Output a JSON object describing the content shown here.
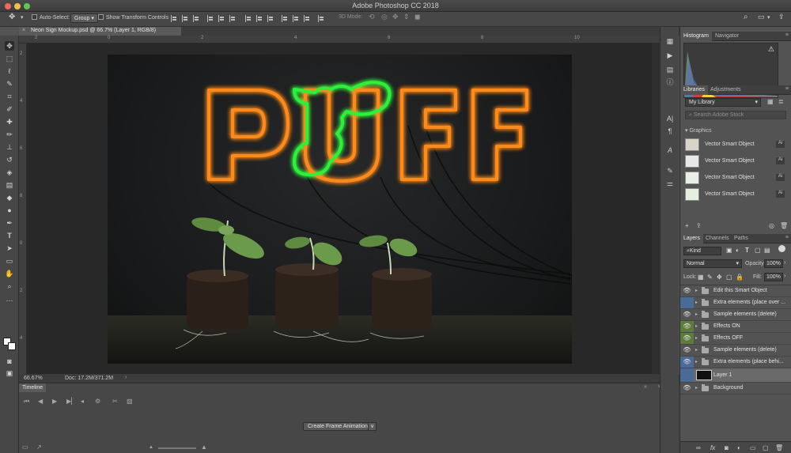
{
  "window": {
    "title": "Adobe Photoshop CC 2018"
  },
  "options_bar": {
    "auto_select_label": "Auto-Select:",
    "auto_select_value": "Group",
    "transform_controls_label": "Show Transform Controls",
    "mode_3d_label": "3D Mode:"
  },
  "document_tab": {
    "label": "Neon Sign Mockup.psd @ 66.7% (Layer 1, RGB/8)"
  },
  "ruler": {
    "top_ticks": [
      "2",
      "0",
      "2",
      "4",
      "6",
      "8",
      "10",
      "12",
      "14",
      "16",
      "18",
      "20",
      "22",
      "24",
      "26"
    ],
    "left_ticks": [
      "2",
      "4",
      "6",
      "8",
      "0",
      "2",
      "4",
      "6",
      "8",
      "4",
      "4",
      "6",
      "8",
      "6"
    ]
  },
  "artwork": {
    "sign_text": [
      "P",
      "U",
      "F",
      "F"
    ],
    "neon_orange": "#ff8a1f",
    "neon_green": "#2ef03a"
  },
  "status_bar": {
    "zoom": "66.67%",
    "doc": "Doc: 17.2M/371.2M"
  },
  "timeline": {
    "tab_label": "Timeline",
    "create_button": "Create Frame Animation"
  },
  "histogram_panel": {
    "tabs": [
      "Histogram",
      "Navigator"
    ]
  },
  "libraries_panel": {
    "tabs": [
      "Libraries",
      "Adjustments"
    ],
    "library_name": "My Library",
    "search_placeholder": "Search Adobe Stock",
    "section_label": "Graphics",
    "items": [
      {
        "name": "Vector Smart Object",
        "type": "Ai"
      },
      {
        "name": "Vector Smart Object",
        "type": "Ai"
      },
      {
        "name": "Vector Smart Object",
        "type": "Ai"
      },
      {
        "name": "Vector Smart Object",
        "type": "Ai"
      }
    ]
  },
  "layers_panel": {
    "tabs": [
      "Layers",
      "Channels",
      "Paths"
    ],
    "filter_label": "Kind",
    "blend_mode": "Normal",
    "opacity_label": "Opacity:",
    "opacity_value": "100%",
    "lock_label": "Lock:",
    "fill_label": "Fill:",
    "fill_value": "100%",
    "layers": [
      {
        "name": "Edit this Smart Object",
        "kind": "folder",
        "visible": true,
        "color": ""
      },
      {
        "name": "Extra elements (place over ...",
        "kind": "folder",
        "visible": false,
        "color": "#4b6a96"
      },
      {
        "name": "Sample elements (delete)",
        "kind": "folder",
        "visible": true,
        "color": ""
      },
      {
        "name": "Effects ON",
        "kind": "folder",
        "visible": true,
        "color": "#5c7d3a"
      },
      {
        "name": "Effects OFF",
        "kind": "folder",
        "visible": true,
        "color": "#5c7d3a"
      },
      {
        "name": "Sample elements (delete)",
        "kind": "folder",
        "visible": true,
        "color": ""
      },
      {
        "name": "Extra elements (place behi...",
        "kind": "folder",
        "visible": true,
        "color": "#4b6a96"
      },
      {
        "name": "Layer 1",
        "kind": "image",
        "visible": false,
        "color": "#4b6a96"
      },
      {
        "name": "Background",
        "kind": "folder",
        "visible": true,
        "color": ""
      }
    ],
    "footer_icons": [
      "link-icon",
      "fx-icon",
      "mask-icon",
      "adjustment-icon",
      "new-group-icon",
      "new-layer-icon",
      "trash-icon"
    ]
  }
}
